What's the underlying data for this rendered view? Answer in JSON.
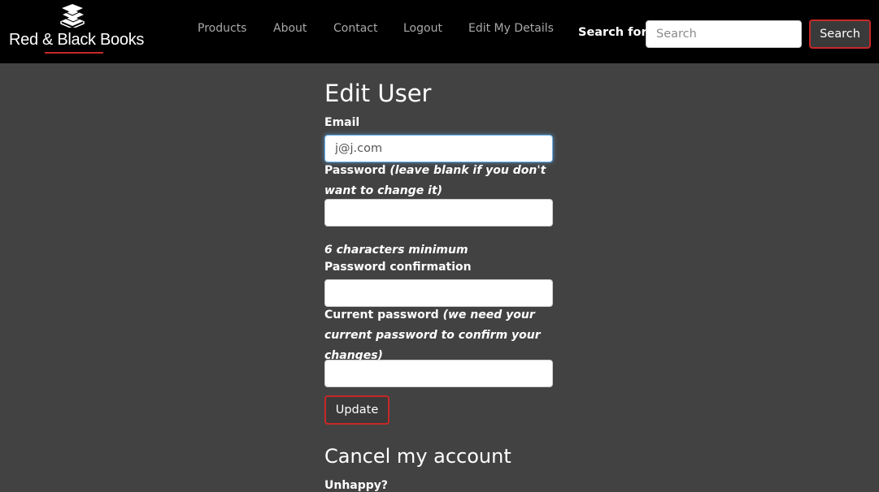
{
  "navbar": {
    "brand": "Red & Black Books",
    "brand_icon": "book-stack-icon",
    "links": [
      "Products",
      "About",
      "Contact",
      "Logout",
      "Edit My Details"
    ],
    "search": {
      "label": "Search for:",
      "placeholder": "Search",
      "button_label": "Search"
    }
  },
  "colors": {
    "navbar_bg": "#000000",
    "page_bg": "#424242",
    "accent": "#c62828"
  },
  "form": {
    "title": "Edit User",
    "email": {
      "label": "Email",
      "value": "j@j.com"
    },
    "password": {
      "label": "Password",
      "hint": "(leave blank if you don't want to change it)",
      "value": "",
      "minimum_note": "6 characters minimum"
    },
    "password_confirmation": {
      "label": "Password confirmation",
      "value": ""
    },
    "current_password": {
      "label": "Current password",
      "hint": "(we need your current password to confirm your changes)",
      "value": ""
    },
    "submit_label": "Update"
  },
  "cancel_section": {
    "title": "Cancel my account",
    "text": "Unhappy?"
  }
}
